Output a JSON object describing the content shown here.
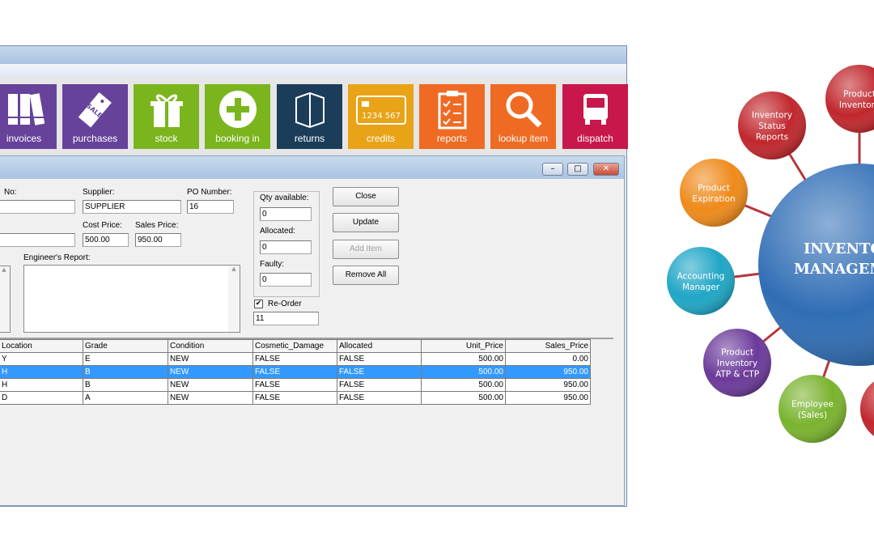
{
  "toolbar": {
    "tiles": [
      {
        "label": "invoices",
        "icon": "books-icon",
        "color": "#66429a"
      },
      {
        "label": "purchases",
        "icon": "sale-tag-icon",
        "color": "#66429a"
      },
      {
        "label": "stock",
        "icon": "gift-icon",
        "color": "#7ab51d"
      },
      {
        "label": "booking in",
        "icon": "plus-circle-icon",
        "color": "#7ab51d"
      },
      {
        "label": "returns",
        "icon": "box-icon",
        "color": "#1c3d5a"
      },
      {
        "label": "credits",
        "icon": "credit-card-icon",
        "color": "#e8a317"
      },
      {
        "label": "reports",
        "icon": "clipboard-checklist-icon",
        "color": "#ef6a23"
      },
      {
        "label": "lookup item",
        "icon": "magnifier-icon",
        "color": "#ef6a23"
      },
      {
        "label": "dispatch",
        "icon": "truck-icon",
        "color": "#c8174b"
      }
    ],
    "card_number": "1234 567"
  },
  "window_controls": {
    "minimize": "–",
    "maximize": "□",
    "close": "✕"
  },
  "form": {
    "no_label": "No:",
    "no_value": "",
    "supplier_label": "Supplier:",
    "supplier_value": "SUPPLIER",
    "po_label": "PO Number:",
    "po_value": "16",
    "field2_value": "",
    "cost_label": "Cost Price:",
    "cost_value": "500.00",
    "sales_label": "Sales Price:",
    "sales_value": "950.00",
    "engineer_label": "Engineer's Report:",
    "engineer_value": "",
    "qty_label": "Qty available:",
    "qty_value": "0",
    "allocated_label": "Allocated:",
    "allocated_value": "0",
    "faulty_label": "Faulty:",
    "faulty_value": "0",
    "reorder_label": "Re-Order",
    "reorder_checked": true,
    "reorder_value": "11"
  },
  "buttons": {
    "close": "Close",
    "update": "Update",
    "add_item": "Add Item",
    "remove_all": "Remove All"
  },
  "table": {
    "columns": [
      "Location",
      "Grade",
      "Condition",
      "Cosmetic_Damage",
      "Allocated",
      "Unit_Price",
      "Sales_Price"
    ],
    "rows": [
      [
        "Y",
        "E",
        "NEW",
        "FALSE",
        "FALSE",
        "500.00",
        "0.00"
      ],
      [
        "H",
        "B",
        "NEW",
        "FALSE",
        "FALSE",
        "500.00",
        "950.00"
      ],
      [
        "H",
        "B",
        "NEW",
        "FALSE",
        "FALSE",
        "500.00",
        "950.00"
      ],
      [
        "D",
        "A",
        "NEW",
        "FALSE",
        "FALSE",
        "500.00",
        "950.00"
      ]
    ],
    "selected_row": 1,
    "selection_color": "#3399ff"
  },
  "diagram": {
    "center": [
      "INVENTO",
      "MANAGEM"
    ],
    "nodes": [
      {
        "lines": [
          "Inventory",
          "Status",
          "Reports"
        ],
        "color": "#c0272d"
      },
      {
        "lines": [
          "Product",
          "Inventory"
        ],
        "color": "#c0272d"
      },
      {
        "lines": [
          "Product",
          "Expiration"
        ],
        "color": "#ef8a1a"
      },
      {
        "lines": [
          "Accounting",
          "Manager"
        ],
        "color": "#1fa6c6"
      },
      {
        "lines": [
          "Product",
          "Inventory",
          "ATP & CTP"
        ],
        "color": "#6b3a9a"
      },
      {
        "lines": [
          "Employee",
          "(Sales)"
        ],
        "color": "#7ab32e"
      },
      {
        "lines": [],
        "color": "#c0272d"
      }
    ],
    "center_color": "#2f6db5"
  }
}
